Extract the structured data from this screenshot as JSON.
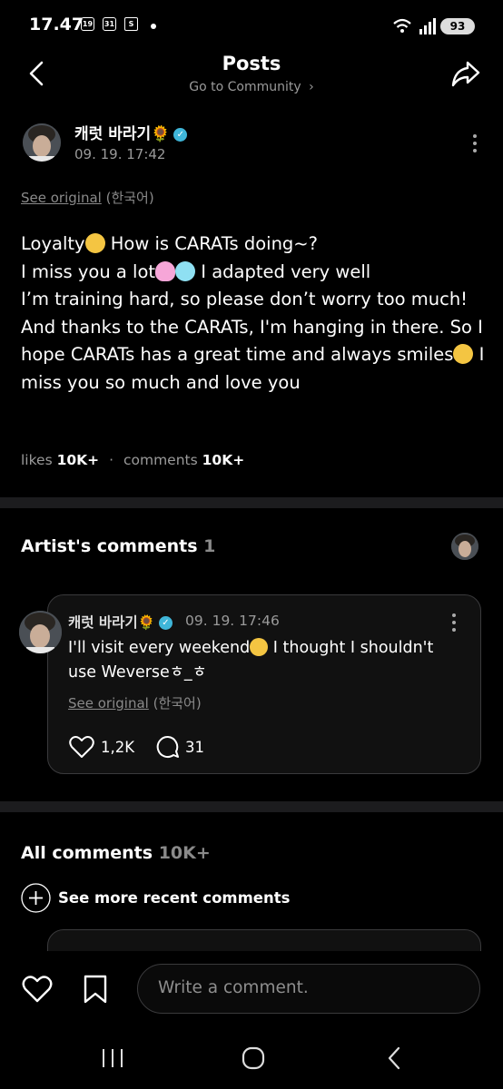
{
  "status_bar": {
    "time": "17.47",
    "icon_a": "19",
    "icon_b": "31",
    "icon_c": "S",
    "battery": "93"
  },
  "header": {
    "title": "Posts",
    "subtitle": "Go to Community"
  },
  "post": {
    "author": "캐럿 바라기🌻",
    "date": "09. 19. 17:42",
    "see_original": "See original",
    "language": "(한국어)",
    "lines": [
      "Loyalty",
      " How is CARATs doing~?",
      "I miss you a lot",
      " I adapted very well",
      "I’m training hard, so please don’t worry too much!",
      "And thanks to the CARATs, I'm hanging in there. So I hope CARATs has a great time and always smiles",
      " I miss you so much and love you"
    ],
    "likes_label": "likes",
    "likes_count": "10K+",
    "comments_label": "comments",
    "comments_count": "10K+"
  },
  "artist_comments": {
    "title": "Artist's comments",
    "count": "1",
    "comment": {
      "author": "캐럿 바라기🌻",
      "date": "09. 19. 17:46",
      "text": "I'll visit every weekend",
      "text2": " I thought I shouldn't use Weverseㅎ_ㅎ",
      "see_original": "See original",
      "language": "(한국어)",
      "likes": "1,2K",
      "replies": "31"
    }
  },
  "all_comments": {
    "title": "All comments",
    "count": "10K+",
    "see_more": "See more recent comments"
  },
  "composer": {
    "placeholder": "Write a comment."
  },
  "colors": {
    "background": "#000000",
    "verified": "#3fb6d9",
    "divider": "#1c1c1e"
  }
}
